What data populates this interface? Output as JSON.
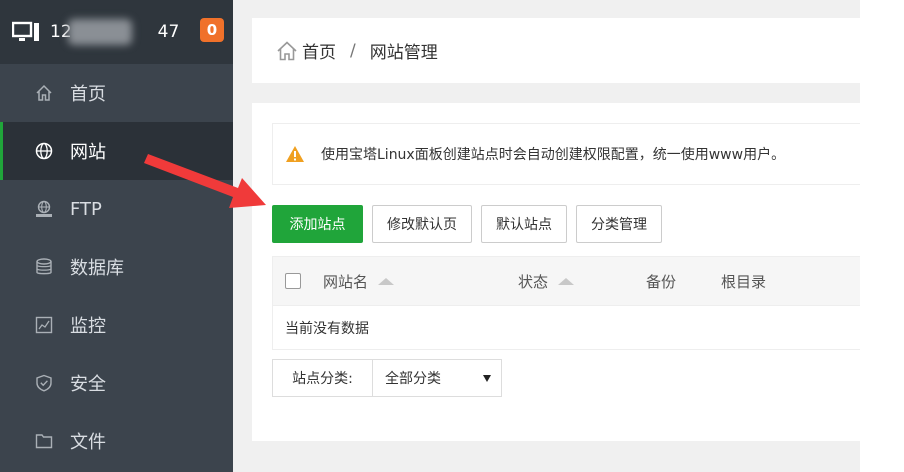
{
  "header": {
    "ip_prefix": "12",
    "ip_suffix": "47",
    "badge_count": "0"
  },
  "sidebar": {
    "items": [
      {
        "label": "首页",
        "icon": "home-icon"
      },
      {
        "label": "网站",
        "icon": "globe-icon",
        "active": true
      },
      {
        "label": "FTP",
        "icon": "ftp-icon"
      },
      {
        "label": "数据库",
        "icon": "database-icon"
      },
      {
        "label": "监控",
        "icon": "monitor-chart-icon"
      },
      {
        "label": "安全",
        "icon": "shield-icon"
      },
      {
        "label": "文件",
        "icon": "folder-icon"
      }
    ]
  },
  "breadcrumb": {
    "home": "首页",
    "separator": "/",
    "current": "网站管理"
  },
  "alert": {
    "text": "使用宝塔Linux面板创建站点时会自动创建权限配置，统一使用www用户。"
  },
  "toolbar": {
    "add_site": "添加站点",
    "edit_default_page": "修改默认页",
    "default_site": "默认站点",
    "category_manage": "分类管理"
  },
  "table": {
    "columns": [
      "网站名",
      "状态",
      "备份",
      "根目录"
    ],
    "empty_text": "当前没有数据"
  },
  "category": {
    "label": "站点分类:",
    "selected": "全部分类"
  },
  "colors": {
    "sidebar_bg": "#3c444d",
    "active_bg": "#2b3138",
    "accent_green": "#20a53a",
    "badge_orange": "#f0712a",
    "warning_orange": "#f0a020",
    "arrow_red": "#f03a3a"
  }
}
